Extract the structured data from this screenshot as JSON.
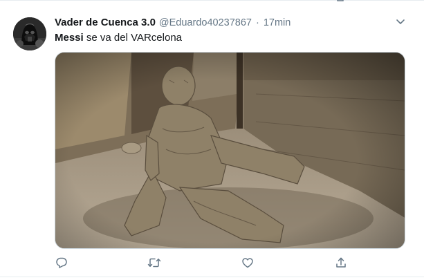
{
  "tweet": {
    "display_name": "Vader de Cuenca 3.0",
    "handle": "@Eduardo40237867",
    "separator": "·",
    "time": "17min",
    "text_bold": "Messi",
    "text_rest": " se va del VARcelona"
  },
  "icons": {
    "avatar": "darth-vader-avatar",
    "more": "chevron-down-icon",
    "reply": "reply-icon",
    "retweet": "retweet-icon",
    "like": "heart-icon",
    "share": "share-icon"
  },
  "colors": {
    "text": "#14171a",
    "secondary": "#657786",
    "icon": "#657786",
    "border": "#e6ecf0"
  }
}
